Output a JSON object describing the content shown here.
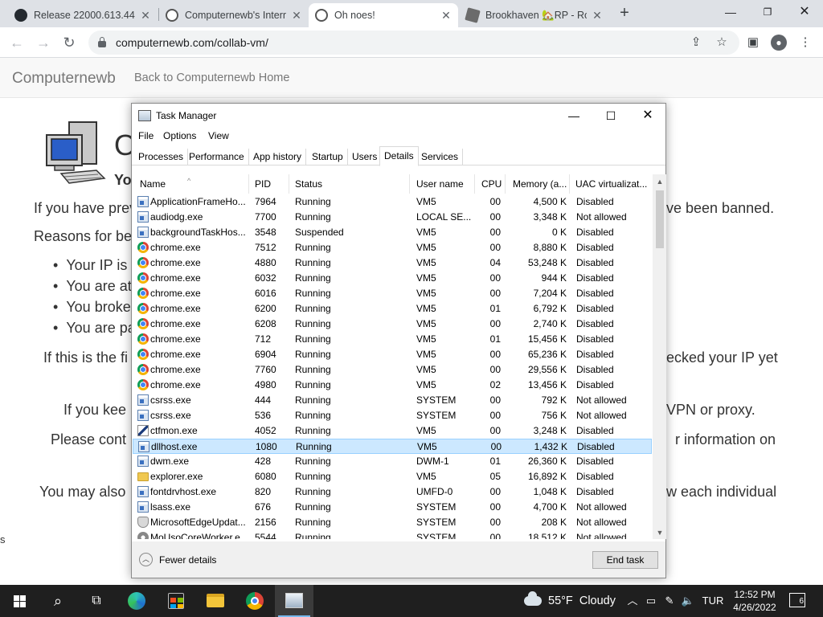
{
  "browser": {
    "tabs": [
      {
        "title": "Release 22000.613.44.1",
        "icon": "github-icon"
      },
      {
        "title": "Computernewb's Intern",
        "icon": "computernewb-icon"
      },
      {
        "title": "Oh noes!",
        "icon": "computernewb-icon",
        "active": true
      },
      {
        "title": "Brookhaven 🏡RP - Ro",
        "icon": "roblox-icon"
      }
    ],
    "new_tab": "+",
    "url": "computernewb.com/collab-vm/"
  },
  "page": {
    "brand": "Computernewb",
    "home_link": "Back to Computernewb Home",
    "heading": "O",
    "subheading": "Yo",
    "line1_left": "If you have prev",
    "line1_right": "ve been banned.",
    "reasons": "Reasons for bei",
    "bullets": [
      "Your IP is",
      "You are at",
      "You broke",
      "You are pa"
    ],
    "p2_left": "If this is the fi",
    "p2_right": "ecked your IP yet",
    "p3_left": "If you kee",
    "p3_right": "VPN or proxy.",
    "p4_left": "Please cont",
    "p4_right": "r information on",
    "p5_left": "You may also",
    "p5_right": "w each individual",
    "margin_s": "s"
  },
  "taskmgr": {
    "title": "Task Manager",
    "menu": [
      "File",
      "Options",
      "View"
    ],
    "tabs": [
      "Processes",
      "Performance",
      "App history",
      "Startup",
      "Users",
      "Details",
      "Services"
    ],
    "active_tab": "Details",
    "columns": [
      "Name",
      "PID",
      "Status",
      "User name",
      "CPU",
      "Memory (a...",
      "UAC virtualizat..."
    ],
    "rows": [
      {
        "name": "ApplicationFrameHo...",
        "pid": "7964",
        "status": "Running",
        "user": "VM5",
        "cpu": "00",
        "mem": "4,500 K",
        "uac": "Disabled",
        "icon": "app"
      },
      {
        "name": "audiodg.exe",
        "pid": "7700",
        "status": "Running",
        "user": "LOCAL SE...",
        "cpu": "00",
        "mem": "3,348 K",
        "uac": "Not allowed",
        "icon": "app"
      },
      {
        "name": "backgroundTaskHos...",
        "pid": "3548",
        "status": "Suspended",
        "user": "VM5",
        "cpu": "00",
        "mem": "0 K",
        "uac": "Disabled",
        "icon": "app"
      },
      {
        "name": "chrome.exe",
        "pid": "7512",
        "status": "Running",
        "user": "VM5",
        "cpu": "00",
        "mem": "8,880 K",
        "uac": "Disabled",
        "icon": "chrome"
      },
      {
        "name": "chrome.exe",
        "pid": "4880",
        "status": "Running",
        "user": "VM5",
        "cpu": "04",
        "mem": "53,248 K",
        "uac": "Disabled",
        "icon": "chrome"
      },
      {
        "name": "chrome.exe",
        "pid": "6032",
        "status": "Running",
        "user": "VM5",
        "cpu": "00",
        "mem": "944 K",
        "uac": "Disabled",
        "icon": "chrome"
      },
      {
        "name": "chrome.exe",
        "pid": "6016",
        "status": "Running",
        "user": "VM5",
        "cpu": "00",
        "mem": "7,204 K",
        "uac": "Disabled",
        "icon": "chrome"
      },
      {
        "name": "chrome.exe",
        "pid": "6200",
        "status": "Running",
        "user": "VM5",
        "cpu": "01",
        "mem": "6,792 K",
        "uac": "Disabled",
        "icon": "chrome"
      },
      {
        "name": "chrome.exe",
        "pid": "6208",
        "status": "Running",
        "user": "VM5",
        "cpu": "00",
        "mem": "2,740 K",
        "uac": "Disabled",
        "icon": "chrome"
      },
      {
        "name": "chrome.exe",
        "pid": "712",
        "status": "Running",
        "user": "VM5",
        "cpu": "01",
        "mem": "15,456 K",
        "uac": "Disabled",
        "icon": "chrome"
      },
      {
        "name": "chrome.exe",
        "pid": "6904",
        "status": "Running",
        "user": "VM5",
        "cpu": "00",
        "mem": "65,236 K",
        "uac": "Disabled",
        "icon": "chrome"
      },
      {
        "name": "chrome.exe",
        "pid": "7760",
        "status": "Running",
        "user": "VM5",
        "cpu": "00",
        "mem": "29,556 K",
        "uac": "Disabled",
        "icon": "chrome"
      },
      {
        "name": "chrome.exe",
        "pid": "4980",
        "status": "Running",
        "user": "VM5",
        "cpu": "02",
        "mem": "13,456 K",
        "uac": "Disabled",
        "icon": "chrome"
      },
      {
        "name": "csrss.exe",
        "pid": "444",
        "status": "Running",
        "user": "SYSTEM",
        "cpu": "00",
        "mem": "792 K",
        "uac": "Not allowed",
        "icon": "app"
      },
      {
        "name": "csrss.exe",
        "pid": "536",
        "status": "Running",
        "user": "SYSTEM",
        "cpu": "00",
        "mem": "756 K",
        "uac": "Not allowed",
        "icon": "app"
      },
      {
        "name": "ctfmon.exe",
        "pid": "4052",
        "status": "Running",
        "user": "VM5",
        "cpu": "00",
        "mem": "3,248 K",
        "uac": "Disabled",
        "icon": "pen"
      },
      {
        "name": "dllhost.exe",
        "pid": "1080",
        "status": "Running",
        "user": "VM5",
        "cpu": "00",
        "mem": "1,432 K",
        "uac": "Disabled",
        "icon": "app",
        "selected": true
      },
      {
        "name": "dwm.exe",
        "pid": "428",
        "status": "Running",
        "user": "DWM-1",
        "cpu": "01",
        "mem": "26,360 K",
        "uac": "Disabled",
        "icon": "app"
      },
      {
        "name": "explorer.exe",
        "pid": "6080",
        "status": "Running",
        "user": "VM5",
        "cpu": "05",
        "mem": "16,892 K",
        "uac": "Disabled",
        "icon": "folder"
      },
      {
        "name": "fontdrvhost.exe",
        "pid": "820",
        "status": "Running",
        "user": "UMFD-0",
        "cpu": "00",
        "mem": "1,048 K",
        "uac": "Disabled",
        "icon": "app"
      },
      {
        "name": "lsass.exe",
        "pid": "676",
        "status": "Running",
        "user": "SYSTEM",
        "cpu": "00",
        "mem": "4,700 K",
        "uac": "Not allowed",
        "icon": "app"
      },
      {
        "name": "MicrosoftEdgeUpdat...",
        "pid": "2156",
        "status": "Running",
        "user": "SYSTEM",
        "cpu": "00",
        "mem": "208 K",
        "uac": "Not allowed",
        "icon": "shield"
      },
      {
        "name": "MoUsoCoreWorker.e...",
        "pid": "5544",
        "status": "Running",
        "user": "SYSTEM",
        "cpu": "00",
        "mem": "18,512 K",
        "uac": "Not allowed",
        "icon": "gear"
      }
    ],
    "fewer_details": "Fewer details",
    "end_task": "End task"
  },
  "taskbar": {
    "weather": "55°F  Cloudy",
    "language": "TUR",
    "time": "12:52 PM",
    "date": "4/26/2022",
    "notification_count": "6"
  }
}
